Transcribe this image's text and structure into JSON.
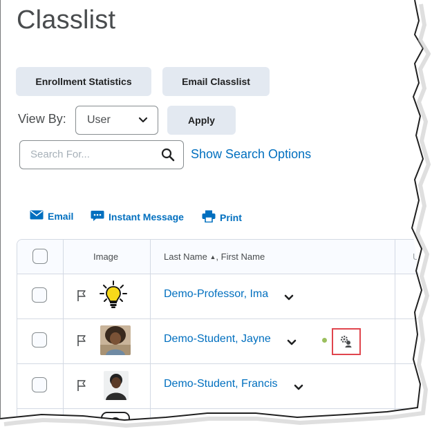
{
  "page": {
    "title": "Classlist"
  },
  "actions": {
    "enrollment_statistics": "Enrollment Statistics",
    "email_classlist": "Email Classlist"
  },
  "view_by": {
    "label": "View By:",
    "selected": "User",
    "apply_label": "Apply"
  },
  "search": {
    "placeholder": "Search For...",
    "show_options_label": "Show Search Options"
  },
  "toolbar": {
    "email_label": "Email",
    "instant_message_label": "Instant Message",
    "print_label": "Print"
  },
  "table": {
    "columns": {
      "image": "Image",
      "last_name": "Last Name",
      "sort_indicator": "▲",
      "first_name_suffix": ", First Name"
    },
    "rows": [
      {
        "name": "Demo-Professor, Ima",
        "avatar": "lightbulb-icon"
      },
      {
        "name": "Demo-Student, Jayne",
        "avatar": "student-photo",
        "status": "online"
      },
      {
        "name": "Demo-Student, Francis",
        "avatar": "student-photo"
      }
    ]
  },
  "colors": {
    "link": "#006fbf",
    "button_bg": "#e3e9f1",
    "highlight_box": "#e0454d",
    "online_dot": "#9bbf5e"
  }
}
